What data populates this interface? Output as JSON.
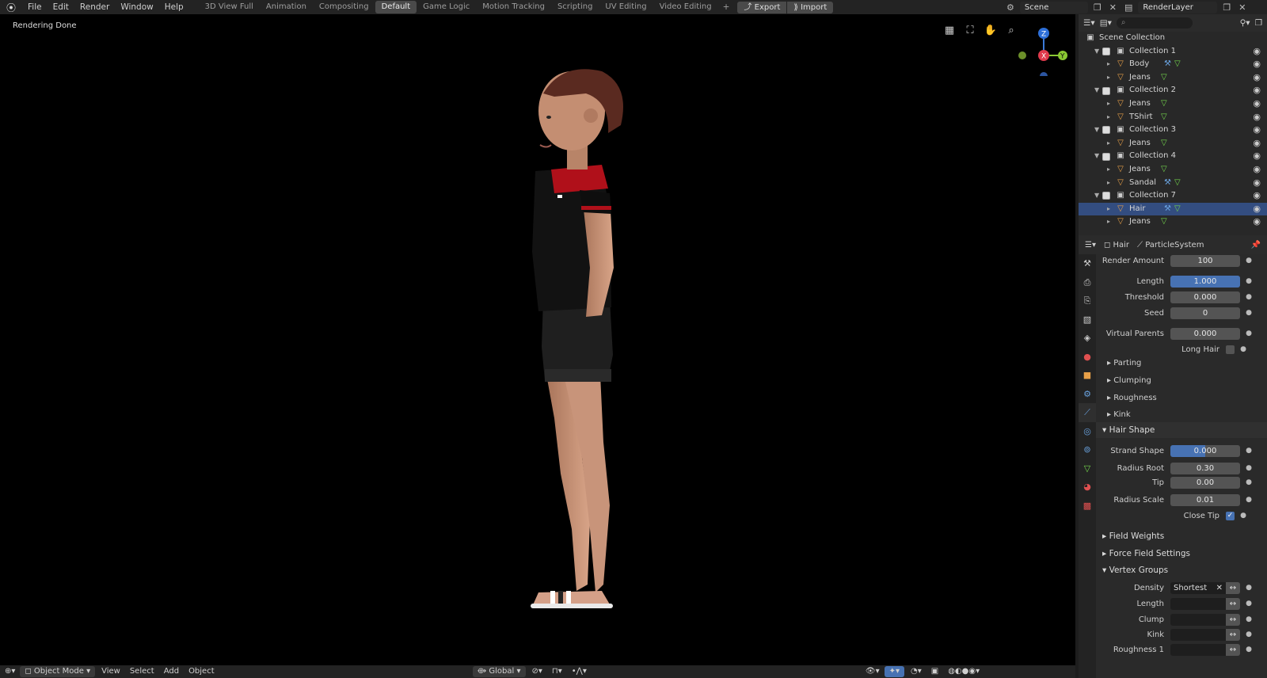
{
  "menu": [
    "File",
    "Edit",
    "Render",
    "Window",
    "Help"
  ],
  "workspace_tabs": [
    "3D View Full",
    "Animation",
    "Compositing",
    "Default",
    "Game Logic",
    "Motion Tracking",
    "Scripting",
    "UV Editing",
    "Video Editing"
  ],
  "active_tab": "Default",
  "export_label": "Export",
  "import_label": "Import",
  "scene_name": "Scene",
  "render_layer": "RenderLayer",
  "viewport": {
    "status": "Rendering Done"
  },
  "gizmo": {
    "z": "Z",
    "x": "X",
    "y": "Y"
  },
  "bottombar": {
    "mode": "Object Mode",
    "view": "View",
    "select": "Select",
    "add": "Add",
    "object": "Object",
    "transform": "Global"
  },
  "outliner": {
    "root": "Scene Collection",
    "rows": [
      {
        "label": "Collection 1",
        "type": "collection"
      },
      {
        "label": "Body",
        "type": "mesh",
        "mod": true
      },
      {
        "label": "Jeans",
        "type": "mesh"
      },
      {
        "label": "Collection 2",
        "type": "collection"
      },
      {
        "label": "Jeans",
        "type": "mesh"
      },
      {
        "label": "TShirt",
        "type": "mesh"
      },
      {
        "label": "Collection 3",
        "type": "collection"
      },
      {
        "label": "Jeans",
        "type": "mesh"
      },
      {
        "label": "Collection 4",
        "type": "collection"
      },
      {
        "label": "Jeans",
        "type": "mesh"
      },
      {
        "label": "Sandal",
        "type": "mesh",
        "mod": true
      },
      {
        "label": "Collection 7",
        "type": "collection"
      },
      {
        "label": "Hair",
        "type": "mesh",
        "mod": true,
        "selected": true
      },
      {
        "label": "Jeans",
        "type": "mesh"
      }
    ]
  },
  "props": {
    "object": "Hair",
    "system": "ParticleSystem",
    "render_amount": {
      "label": "Render Amount",
      "value": "100"
    },
    "length": {
      "label": "Length",
      "value": "1.000"
    },
    "threshold": {
      "label": "Threshold",
      "value": "0.000"
    },
    "seed": {
      "label": "Seed",
      "value": "0"
    },
    "virtual_parents": {
      "label": "Virtual Parents",
      "value": "0.000"
    },
    "long_hair": {
      "label": "Long Hair"
    },
    "subpanels": [
      "Parting",
      "Clumping",
      "Roughness",
      "Kink"
    ],
    "hair_shape": "Hair Shape",
    "strand_shape": {
      "label": "Strand Shape",
      "value": "0.000"
    },
    "radius_root": {
      "label": "Radius Root",
      "value": "0.30"
    },
    "tip": {
      "label": "Tip",
      "value": "0.00"
    },
    "radius_scale": {
      "label": "Radius Scale",
      "value": "0.01"
    },
    "close_tip": {
      "label": "Close Tip"
    },
    "field_weights": "Field Weights",
    "force_field": "Force Field Settings",
    "vertex_groups": "Vertex Groups",
    "vg_rows": [
      {
        "label": "Density",
        "value": "Shortest"
      },
      {
        "label": "Length",
        "value": ""
      },
      {
        "label": "Clump",
        "value": ""
      },
      {
        "label": "Kink",
        "value": ""
      },
      {
        "label": "Roughness 1",
        "value": ""
      }
    ]
  }
}
